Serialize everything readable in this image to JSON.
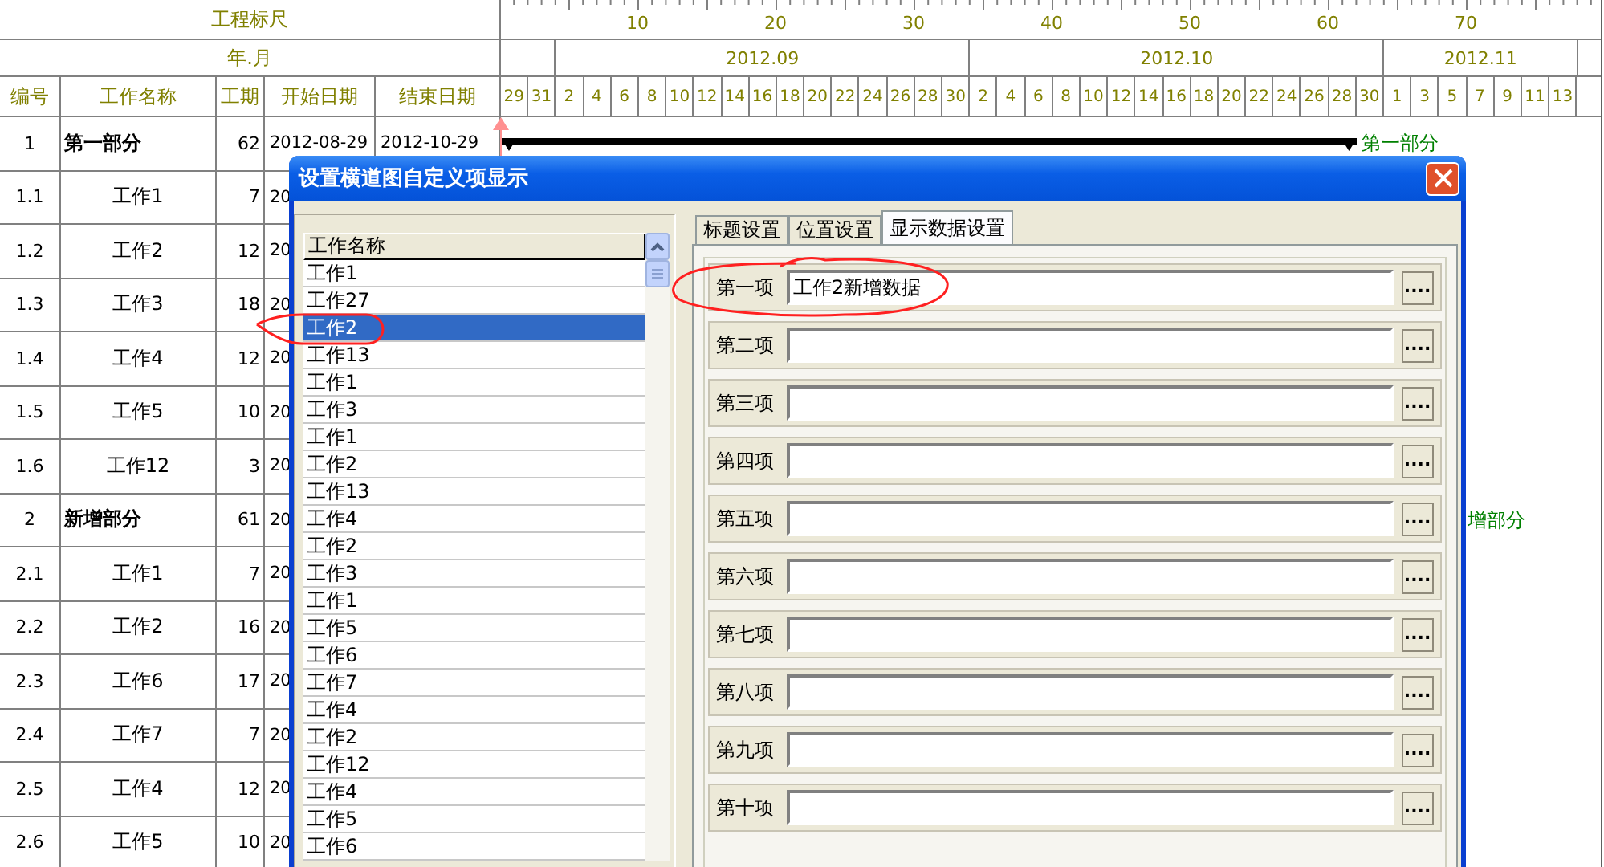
{
  "ruler": {
    "title": "工程标尺",
    "labels": [
      "10",
      "20",
      "30",
      "40",
      "50",
      "60",
      "70"
    ]
  },
  "month_row": {
    "title": "年.月",
    "months": [
      {
        "days": [
          "29",
          "31"
        ]
      },
      {
        "label": "2012.09",
        "days": [
          "2",
          "4",
          "6",
          "8",
          "10",
          "12",
          "14",
          "16",
          "18",
          "20",
          "22",
          "24",
          "26",
          "28",
          "30"
        ]
      },
      {
        "label": "2012.10",
        "days": [
          "2",
          "4",
          "6",
          "8",
          "10",
          "12",
          "14",
          "16",
          "18",
          "20",
          "22",
          "24",
          "26",
          "28",
          "30"
        ]
      },
      {
        "label": "2012.11",
        "days": [
          "1",
          "3",
          "5",
          "7",
          "9",
          "11",
          "13"
        ]
      }
    ]
  },
  "columns": [
    "编号",
    "工作名称",
    "工期",
    "开始日期",
    "结束日期"
  ],
  "rows": [
    {
      "no": "1",
      "name": "第一部分",
      "kind": "summary",
      "duration": "62",
      "start": "2012-08-29",
      "end": "2012-10-29",
      "bar_label": "第一部分"
    },
    {
      "no": "1.1",
      "name": "工作1",
      "kind": "task",
      "duration": "7",
      "start": "20"
    },
    {
      "no": "1.2",
      "name": "工作2",
      "kind": "task",
      "duration": "12",
      "start": "20"
    },
    {
      "no": "1.3",
      "name": "工作3",
      "kind": "task",
      "duration": "18",
      "start": "20"
    },
    {
      "no": "1.4",
      "name": "工作4",
      "kind": "task",
      "duration": "12",
      "start": "20"
    },
    {
      "no": "1.5",
      "name": "工作5",
      "kind": "task",
      "duration": "10",
      "start": "20"
    },
    {
      "no": "1.6",
      "name": "工作12",
      "kind": "task",
      "duration": "3",
      "start": "20"
    },
    {
      "no": "2",
      "name": "新增部分",
      "kind": "summary",
      "duration": "61",
      "start": "20",
      "bar_label": "增部分"
    },
    {
      "no": "2.1",
      "name": "工作1",
      "kind": "task",
      "duration": "7",
      "start": "20"
    },
    {
      "no": "2.2",
      "name": "工作2",
      "kind": "task",
      "duration": "16",
      "start": "20"
    },
    {
      "no": "2.3",
      "name": "工作6",
      "kind": "task",
      "duration": "17",
      "start": "20"
    },
    {
      "no": "2.4",
      "name": "工作7",
      "kind": "task",
      "duration": "7",
      "start": "20"
    },
    {
      "no": "2.5",
      "name": "工作4",
      "kind": "task",
      "duration": "12",
      "start": "20"
    },
    {
      "no": "2.6",
      "name": "工作5",
      "kind": "task",
      "duration": "10",
      "start": "20"
    }
  ],
  "dialog": {
    "title": "设置横道图自定义项显示",
    "list": {
      "header": "工作名称",
      "items": [
        {
          "label": "工作1",
          "selected": false
        },
        {
          "label": "工作27",
          "selected": false
        },
        {
          "label": "工作2",
          "selected": true
        },
        {
          "label": "工作13",
          "selected": false
        },
        {
          "label": "工作1",
          "selected": false
        },
        {
          "label": "工作3",
          "selected": false
        },
        {
          "label": "工作1",
          "selected": false
        },
        {
          "label": "工作2",
          "selected": false
        },
        {
          "label": "工作13",
          "selected": false
        },
        {
          "label": "工作4",
          "selected": false
        },
        {
          "label": "工作2",
          "selected": false
        },
        {
          "label": "工作3",
          "selected": false
        },
        {
          "label": "工作1",
          "selected": false
        },
        {
          "label": "工作5",
          "selected": false
        },
        {
          "label": "工作6",
          "selected": false
        },
        {
          "label": "工作7",
          "selected": false
        },
        {
          "label": "工作4",
          "selected": false
        },
        {
          "label": "工作2",
          "selected": false
        },
        {
          "label": "工作12",
          "selected": false
        },
        {
          "label": "工作4",
          "selected": false
        },
        {
          "label": "工作5",
          "selected": false
        },
        {
          "label": "工作6",
          "selected": false
        }
      ]
    },
    "tabs": [
      {
        "label": "标题设置",
        "selected": false
      },
      {
        "label": "位置设置",
        "selected": false
      },
      {
        "label": "显示数据设置",
        "selected": true
      }
    ],
    "fields": [
      {
        "label": "第一项",
        "value": "工作2新增数据",
        "button": "...."
      },
      {
        "label": "第二项",
        "button": "...."
      },
      {
        "label": "第三项",
        "button": "...."
      },
      {
        "label": "第四项",
        "button": "...."
      },
      {
        "label": "第五项",
        "button": "...."
      },
      {
        "label": "第六项",
        "button": "...."
      },
      {
        "label": "第七项",
        "button": "...."
      },
      {
        "label": "第八项",
        "button": "...."
      },
      {
        "label": "第九项",
        "button": "...."
      },
      {
        "label": "第十项",
        "button": "...."
      }
    ]
  }
}
